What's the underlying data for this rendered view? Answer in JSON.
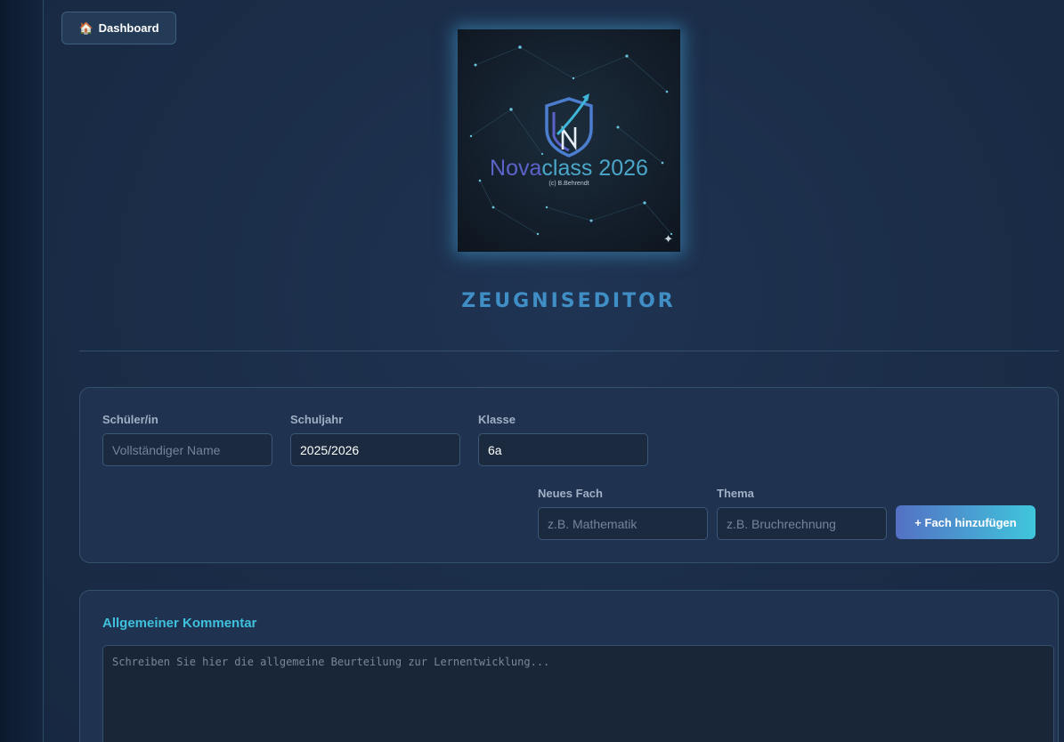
{
  "nav": {
    "dashboard_icon": "house-icon",
    "dashboard_label": "Dashboard"
  },
  "logo": {
    "title_part1": "Nova",
    "title_part2": "class 2026",
    "subtitle": "(c) B.Behrendt",
    "sparkle_icon": "sparkle-icon"
  },
  "page_title": "ZEUGNISEDITOR",
  "form": {
    "student_label": "Schüler/in",
    "student_placeholder": "Vollständiger Name",
    "student_value": "",
    "year_label": "Schuljahr",
    "year_value": "2025/2026",
    "class_label": "Klasse",
    "class_value": "6a",
    "subject_label": "Neues Fach",
    "subject_placeholder": "z.B. Mathematik",
    "topic_label": "Thema",
    "topic_placeholder": "z.B. Bruchrechnung",
    "add_button": "+ Fach hinzufügen"
  },
  "comment": {
    "title": "Allgemeiner Kommentar",
    "placeholder": "Schreiben Sie hier die allgemeine Beurteilung zur Lernentwicklung..."
  },
  "colors": {
    "accent": "#3fc0dc",
    "title": "#3f8fc6",
    "button_start": "#5470c4",
    "button_end": "#3fc6dc"
  }
}
